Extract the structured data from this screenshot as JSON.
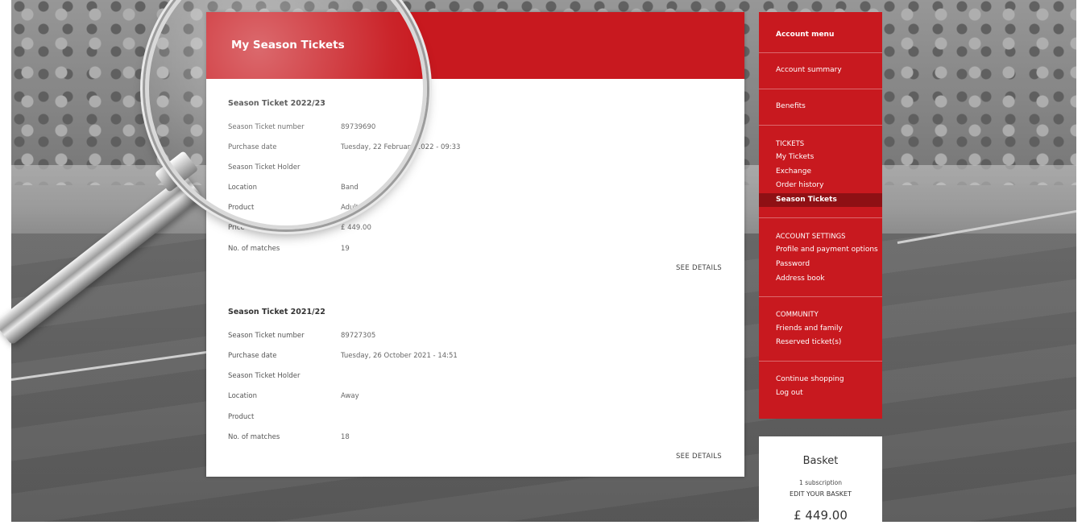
{
  "page": {
    "title": "My Season Tickets"
  },
  "tickets": [
    {
      "title": "Season Ticket 2022/23",
      "rows": [
        {
          "label": "Season Ticket number",
          "value": "89739690"
        },
        {
          "label": "Purchase date",
          "value": "Tuesday, 22 February 2022 - 09:33"
        },
        {
          "label": "Season Ticket Holder",
          "value": ""
        },
        {
          "label": "Location",
          "value": "Band"
        },
        {
          "label": "Product",
          "value": "Adult"
        },
        {
          "label": "Price",
          "value": "£ 449.00"
        },
        {
          "label": "No. of matches",
          "value": "19"
        }
      ],
      "see_details": "SEE DETAILS"
    },
    {
      "title": "Season Ticket 2021/22",
      "rows": [
        {
          "label": "Season Ticket number",
          "value": "89727305"
        },
        {
          "label": "Purchase date",
          "value": "Tuesday, 26 October 2021 - 14:51"
        },
        {
          "label": "Season Ticket Holder",
          "value": ""
        },
        {
          "label": "Location",
          "value": "Away"
        },
        {
          "label": "Product",
          "value": ""
        },
        {
          "label": "No. of matches",
          "value": "18"
        }
      ],
      "see_details": "SEE DETAILS"
    }
  ],
  "menu": {
    "title": "Account menu",
    "summary": "Account summary",
    "benefits": "Benefits",
    "tickets_head": "TICKETS",
    "my_tickets": "My Tickets",
    "exchange": "Exchange",
    "order_history": "Order history",
    "season_tickets": "Season Tickets",
    "settings_head": "ACCOUNT SETTINGS",
    "profile": "Profile and payment options",
    "password": "Password",
    "address": "Address book",
    "community_head": "COMMUNITY",
    "friends": "Friends and family",
    "reserved": "Reserved ticket(s)",
    "continue": "Continue shopping",
    "logout": "Log out"
  },
  "basket": {
    "title": "Basket",
    "subscription": "1 subscription",
    "edit": "EDIT YOUR BASKET",
    "price": "£ 449.00"
  },
  "colors": {
    "brand_red": "#c8191f",
    "active_red": "#8e1014"
  }
}
